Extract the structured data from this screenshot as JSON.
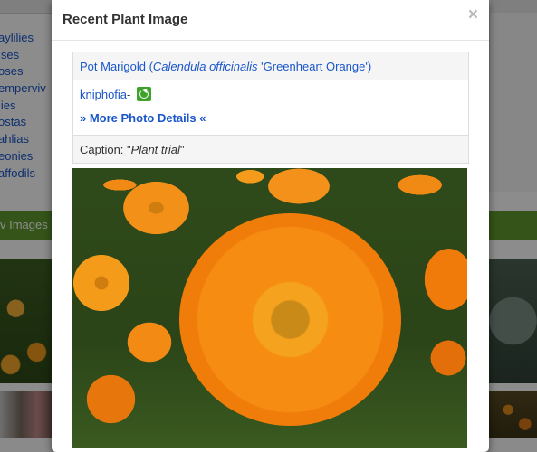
{
  "background": {
    "plant_list": [
      "aylilies",
      "ises",
      "oses",
      "emperviv",
      "lies",
      "ostas",
      "ahlias",
      "eonies",
      "affodils"
    ],
    "section_bar_label": "v Images"
  },
  "modal": {
    "title": "Recent Plant Image",
    "close_label": "×",
    "plant": {
      "prefix": "Pot Marigold (",
      "genus_species": "Calendula officinalis",
      "suffix": " 'Greenheart Orange')"
    },
    "user": {
      "name": "kniphofia",
      "separator": "-",
      "badge_icon": "recycle-icon"
    },
    "more_details": "» More Photo Details «",
    "caption": {
      "label": "Caption: \"",
      "text": "Plant trial",
      "close": "\""
    },
    "photo_alt": "Calendula officinalis 'Greenheart Orange' flower"
  },
  "colors": {
    "link": "#1a56c9",
    "green_bar": "#5f9a2f",
    "badge_green": "#3ea12a"
  }
}
